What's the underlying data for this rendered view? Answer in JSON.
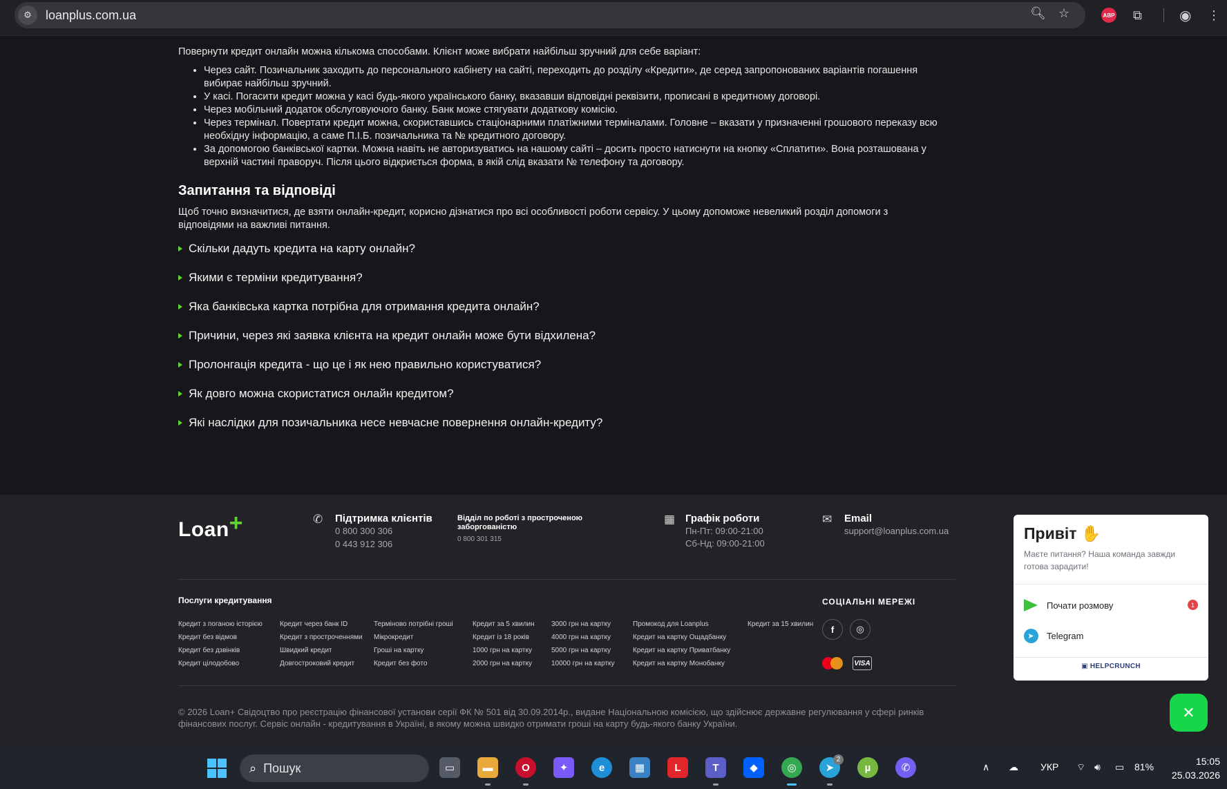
{
  "browser": {
    "url": "loanplus.com.ua",
    "abp_label": "ABP"
  },
  "article": {
    "intro": "Повернути кредит онлайн можна кількома способами. Клієнт може вибрати найбільш зручний для себе варіант:",
    "ways": [
      "Через сайт. Позичальник заходить до персонального кабінету на сайті, переходить до розділу «Кредити», де серед запропонованих варіантів погашення вибирає найбільш зручний.",
      "У касі. Погасити кредит можна у касі будь-якого українського банку, вказавши відповідні реквізити, прописані в кредитному договорі.",
      "Через мобільний додаток обслуговуючого банку. Банк може стягувати додаткову комісію.",
      "Через термінал. Повертати кредит можна, скориставшись стаціонарними платіжними терміналами. Головне – вказати у призначенні грошового переказу всю необхідну інформацію, а саме П.І.Б. позичальника та № кредитного договору.",
      "За допомогою банківської картки. Можна навіть не авторизуватись на нашому сайті – досить просто натиснути на кнопку «Сплатити». Вона розташована у верхній частині праворуч. Після цього відкриється форма, в якій слід вказати № телефону та договору."
    ],
    "faq_title": "Запитання та відповіді",
    "faq_intro": "Щоб точно визначитися, де взяти онлайн-кредит, корисно дізнатися про всі особливості роботи сервісу. У цьому допоможе невеликий розділ допомоги з відповідями на важливі питання.",
    "faq": [
      "Скільки дадуть кредита на карту онлайн?",
      "Якими є терміни кредитування?",
      "Яка банківська картка потрібна для отримання кредита онлайн?",
      "Причини, через які заявка клієнта на кредит онлайн може бути відхилена?",
      "Пролонгація кредита - що це і як нею правильно користуватися?",
      "Як довго можна скористатися онлайн кредитом?",
      "Які наслідки для позичальника несе невчасне повернення онлайн-кредиту?"
    ]
  },
  "footer": {
    "logo_text": "Loan",
    "logo_plus": "+",
    "support": {
      "title": "Підтримка клієнтів",
      "phone1": "0 800 300 306",
      "phone2": "0 443 912 306"
    },
    "overdue": {
      "title": "Відділ по роботі з простроченою заборгованістю",
      "phone": "0 800 301 315"
    },
    "schedule": {
      "title": "Графік роботи",
      "weekdays": "Пн-Пт: 09:00-21:00",
      "weekend": "Сб-Нд: 09:00-21:00"
    },
    "email": {
      "title": "Email",
      "address": "support@loanplus.com.ua"
    },
    "services_title": "Послуги кредитування",
    "services_columns": [
      [
        "Кредит з поганою історією",
        "Кредит без відмов",
        "Кредит без дзвінків",
        "Кредит цілодобово"
      ],
      [
        "Кредит через банк ID",
        "Кредит з простроченнями",
        "Швидкий кредит",
        "Довгостроковий кредит"
      ],
      [
        "Терміново потрібні гроші",
        "Мікрокредит",
        "Гроші на картку",
        "Кредит без фото"
      ],
      [
        "Кредит за 5 хвилин",
        "Кредит із 18 років",
        "1000 грн на картку",
        "2000 грн на картку"
      ],
      [
        "3000 грн на картку",
        "4000 грн на картку",
        "5000 грн на картку",
        "10000 грн на картку"
      ],
      [
        "Промокод для Loanplus",
        "Кредит на картку Ощадбанку",
        "Кредит на картку Приватбанку",
        "Кредит на картку Монобанку"
      ],
      [
        "Кредит за 15 хвилин"
      ]
    ],
    "social_title": "СОЦІАЛЬНІ МЕРЕЖІ",
    "facebook_glyph": "f",
    "instagram_glyph": "◎",
    "visa_label": "VISA",
    "copyright": "© 2026 Loan+ Свідоцтво про реєстрацію фінансової установи серії ФК № 501 від 30.09.2014р., видане Національною комісією, що здійснює державне регулювання у сфері ринків фінансових послуг. Сервіс онлайн - кредитування в Україні, в якому можна швидко отримати гроші на карту будь-якого банку України."
  },
  "chat": {
    "title": "Привіт ✋",
    "subtitle": "Маєте питання? Наша команда завжди готова зарадити!",
    "start_label": "Почати розмову",
    "badge": "1",
    "telegram_label": "Telegram",
    "powered": "HELPCRUNCH",
    "close_glyph": "✕"
  },
  "taskbar": {
    "search_label": "Пошук",
    "lang": "УКР",
    "battery": "81%",
    "time": "15:05",
    "date": "25.03.2026",
    "telegram_badge": "2",
    "l_app_label": "L"
  },
  "colors": {
    "accent_green": "#5fd435",
    "page_bg": "#17171b",
    "footer_bg": "#222227",
    "chat_close": "#17d64a"
  }
}
